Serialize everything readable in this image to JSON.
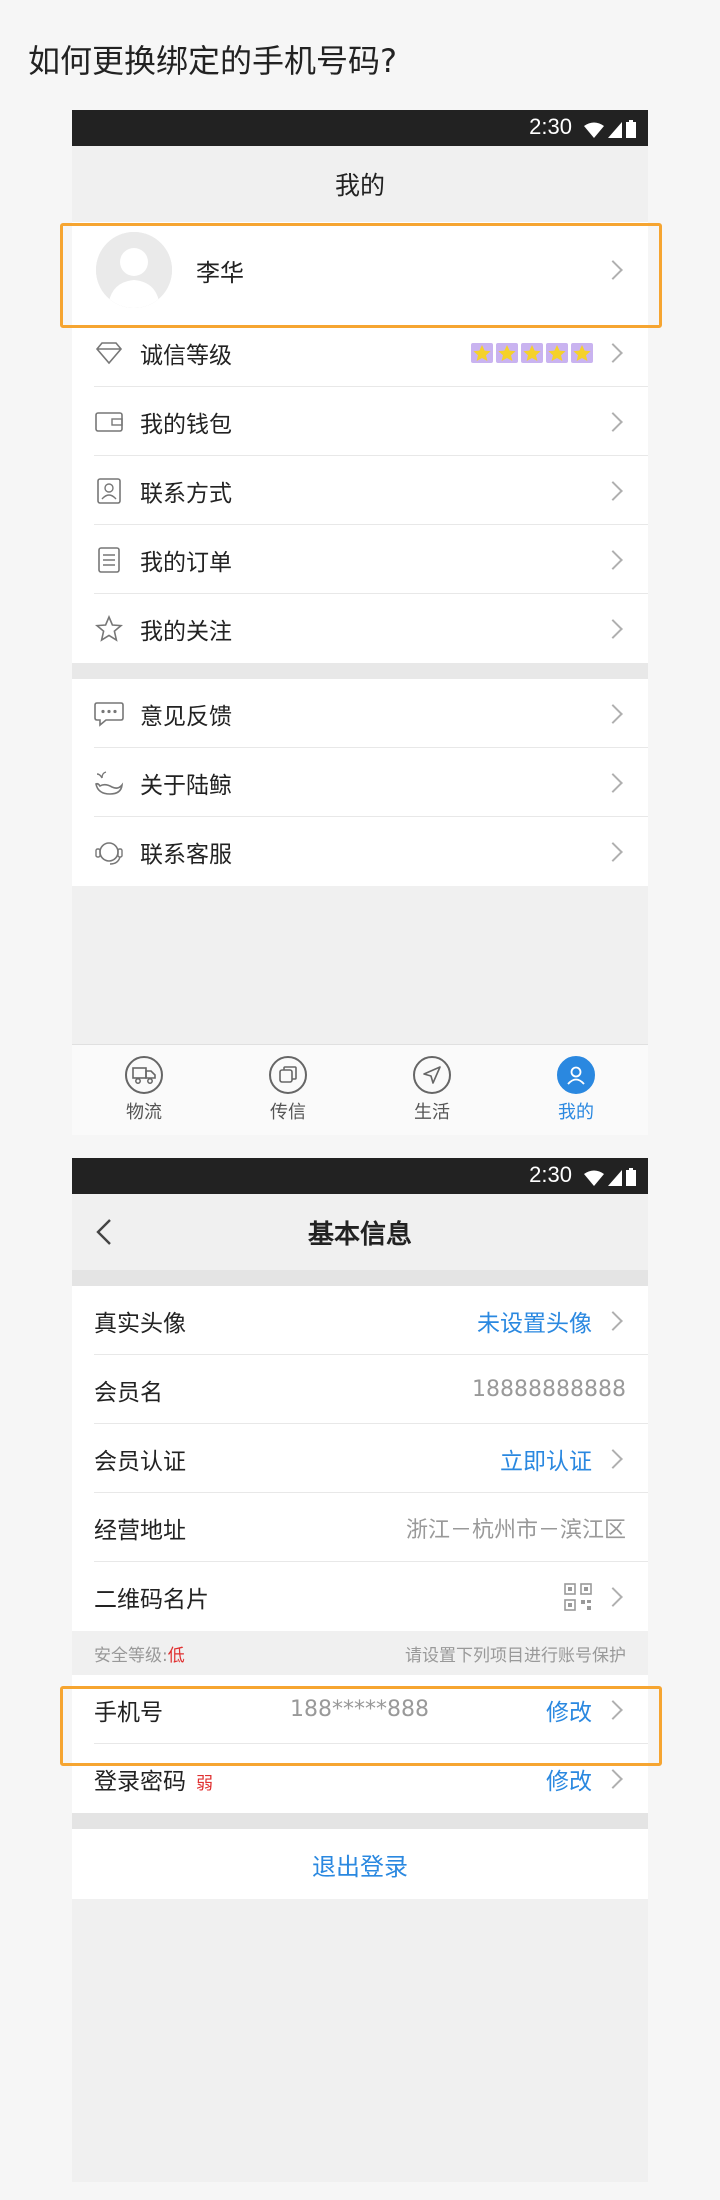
{
  "question": "如何更换绑定的手机号码?",
  "status": {
    "time": "2:30"
  },
  "screen1": {
    "title": "我的",
    "profile_name": "李华",
    "group1": [
      {
        "label": "诚信等级",
        "icon": "diamond-icon",
        "stars": 5
      },
      {
        "label": "我的钱包",
        "icon": "wallet-icon"
      },
      {
        "label": "联系方式",
        "icon": "contact-card-icon"
      },
      {
        "label": "我的订单",
        "icon": "order-list-icon"
      },
      {
        "label": "我的关注",
        "icon": "star-outline-icon"
      }
    ],
    "group2": [
      {
        "label": "意见反馈",
        "icon": "chat-bubble-icon"
      },
      {
        "label": "关于陆鲸",
        "icon": "whale-icon"
      },
      {
        "label": "联系客服",
        "icon": "headset-icon"
      }
    ],
    "tabs": [
      {
        "label": "物流",
        "icon": "truck-icon"
      },
      {
        "label": "传信",
        "icon": "message-icon"
      },
      {
        "label": "生活",
        "icon": "navigation-icon"
      },
      {
        "label": "我的",
        "icon": "person-icon"
      }
    ],
    "active_tab": 3
  },
  "screen2": {
    "title": "基本信息",
    "rows": {
      "avatar": {
        "label": "真实头像",
        "value": "未设置头像"
      },
      "member_name": {
        "label": "会员名",
        "value": "18888888888"
      },
      "verify": {
        "label": "会员认证",
        "value": "立即认证"
      },
      "address": {
        "label": "经营地址",
        "value": "浙江－杭州市－滨江区"
      },
      "qrcode": {
        "label": "二维码名片"
      }
    },
    "security": {
      "level_label": "安全等级:",
      "level_value": "低",
      "hint": "请设置下列项目进行账号保护"
    },
    "phone": {
      "label": "手机号",
      "value": "188*****888",
      "action": "修改"
    },
    "password": {
      "label": "登录密码",
      "weak": "弱",
      "action": "修改"
    },
    "logout": "退出登录"
  },
  "colors": {
    "accent": "#2a88e0",
    "highlight": "#f6a531",
    "warning": "#e03030"
  }
}
